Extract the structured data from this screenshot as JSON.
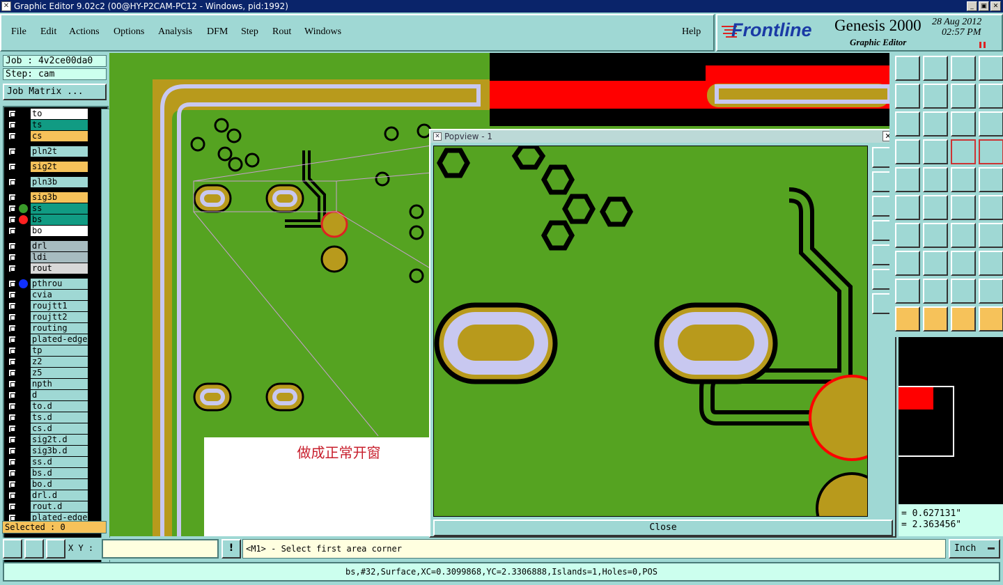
{
  "window": {
    "title": "Graphic Editor 9.02c2 (00@HY-P2CAM-PC12 - Windows, pid:1992)"
  },
  "menu": {
    "items": [
      "File",
      "Edit",
      "Actions",
      "Options",
      "Analysis",
      "DFM",
      "Step",
      "Rout",
      "Windows"
    ],
    "help": "Help"
  },
  "brand": {
    "logo": "Frontline",
    "product": "Genesis 2000",
    "subtitle": "Graphic Editor",
    "date": "28 Aug 2012",
    "time": "02:57 PM"
  },
  "job": {
    "job_label": "Job : 4v2ce00da0",
    "step_label": "Step: cam",
    "matrix_button": "Job Matrix ..."
  },
  "layers": [
    {
      "name": "to",
      "color": "#ffffff"
    },
    {
      "name": "ts",
      "color": "#119b83"
    },
    {
      "name": "cs",
      "color": "#f6c25a"
    },
    {
      "name": "pln2t",
      "color": "#9fd8d4"
    },
    {
      "name": "sig2t",
      "color": "#f6c25a"
    },
    {
      "name": "pln3b",
      "color": "#9fd8d4"
    },
    {
      "name": "sig3b",
      "color": "#f6c25a"
    },
    {
      "name": "ss",
      "color": "#119b83"
    },
    {
      "name": "bs",
      "color": "#119b83"
    },
    {
      "name": "bo",
      "color": "#ffffff"
    },
    {
      "name": "drl",
      "color": "#a7bcc0"
    },
    {
      "name": "ldi",
      "color": "#a7bcc0"
    },
    {
      "name": "rout",
      "color": "#d8d8d8"
    },
    {
      "name": "pthrou",
      "color": "#9fd8d4"
    },
    {
      "name": "cvia",
      "color": "#9fd8d4"
    },
    {
      "name": "roujtt1",
      "color": "#9fd8d4"
    },
    {
      "name": "roujtt2",
      "color": "#9fd8d4"
    },
    {
      "name": "routing",
      "color": "#9fd8d4"
    },
    {
      "name": "plated-edge",
      "color": "#9fd8d4"
    },
    {
      "name": "tp",
      "color": "#9fd8d4"
    },
    {
      "name": "z2",
      "color": "#9fd8d4"
    },
    {
      "name": "z5",
      "color": "#9fd8d4"
    },
    {
      "name": "npth",
      "color": "#9fd8d4"
    },
    {
      "name": "d",
      "color": "#9fd8d4"
    },
    {
      "name": "to.d",
      "color": "#9fd8d4"
    },
    {
      "name": "ts.d",
      "color": "#9fd8d4"
    },
    {
      "name": "cs.d",
      "color": "#9fd8d4"
    },
    {
      "name": "sig2t.d",
      "color": "#9fd8d4"
    },
    {
      "name": "sig3b.d",
      "color": "#9fd8d4"
    },
    {
      "name": "ss.d",
      "color": "#9fd8d4"
    },
    {
      "name": "bs.d",
      "color": "#9fd8d4"
    },
    {
      "name": "bo.d",
      "color": "#9fd8d4"
    },
    {
      "name": "drl.d",
      "color": "#9fd8d4"
    },
    {
      "name": "rout.d",
      "color": "#9fd8d4"
    },
    {
      "name": "plated-edge",
      "color": "#9fd8d4"
    }
  ],
  "selected": "Selected : 0",
  "popview": {
    "title": "Popview - 1",
    "close_label": "Close"
  },
  "annotation": "做成正常开窗",
  "coords": {
    "x": "= 0.627131\"",
    "y": "= 2.363456\""
  },
  "command": {
    "xy_label": "X Y :",
    "xy_value": "",
    "prompt": "<M1> - Select first area corner",
    "units": "Inch"
  },
  "status": "bs,#32,Surface,XC=0.3099868,YC=2.3306888,Islands=1,Holes=0,POS"
}
